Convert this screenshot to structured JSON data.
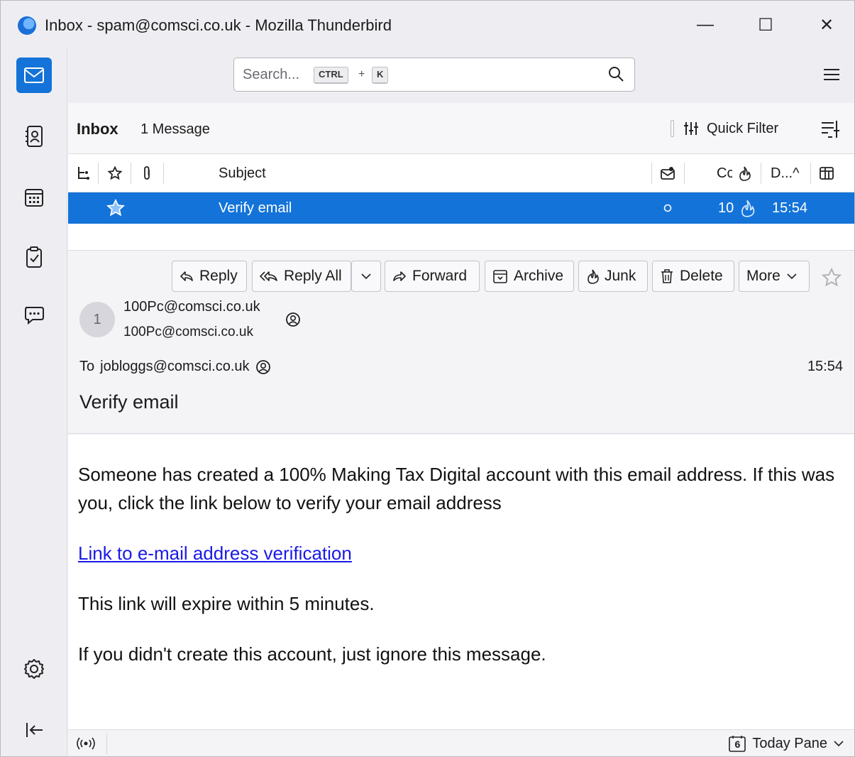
{
  "window": {
    "title": "Inbox - spam@comsci.co.uk - Mozilla Thunderbird",
    "minimize": "—",
    "maximize": "☐",
    "close": "✕"
  },
  "spaces": [
    "mail",
    "address-book",
    "calendar",
    "tasks",
    "chat",
    "settings",
    "collapse"
  ],
  "search": {
    "placeholder": "Search...",
    "key1": "CTRL",
    "plus": "+",
    "key2": "K"
  },
  "thread_header": {
    "folder": "Inbox",
    "count": "1 Message",
    "quick_filter": "Quick Filter"
  },
  "columns": {
    "subject": "Subject",
    "correspondents": "Cc",
    "date": "D...^"
  },
  "messages": [
    {
      "subject": "Verify email",
      "correspondent": "10",
      "date": "15:54",
      "starred": false
    }
  ],
  "message": {
    "buttons": {
      "reply": "Reply",
      "reply_all": "Reply All",
      "forward": "Forward",
      "archive": "Archive",
      "junk": "Junk",
      "delete": "Delete",
      "more": "More"
    },
    "avatar_initial": "1",
    "from_name": "100Pc@comsci.co.uk",
    "from_address": "100Pc@comsci.co.uk",
    "to_label": "To",
    "to_address": "jobloggs@comsci.co.uk",
    "date": "15:54",
    "subject": "Verify email",
    "body": {
      "para1": "Someone has created a 100% Making Tax Digital account with this email address. If this was you, click the link below to verify your email address",
      "link": "Link to e-mail address verification",
      "para2": "This link will expire within 5 minutes.",
      "para3": "If you didn't create this account, just ignore this message."
    }
  },
  "statusbar": {
    "calendar_day": "6",
    "today_pane": "Today Pane"
  },
  "colors": {
    "accent": "#1373d9",
    "link": "#1a1ae6"
  }
}
